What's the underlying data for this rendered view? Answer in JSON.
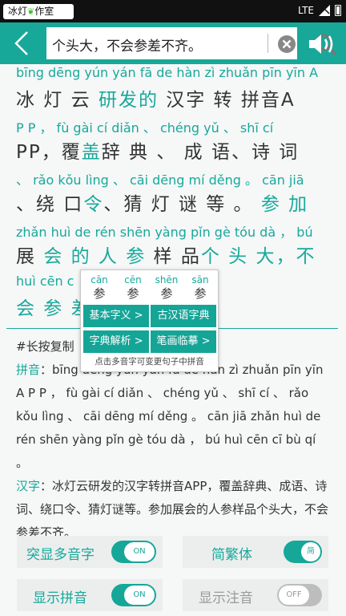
{
  "status_bar": {
    "app_logo_text": "冰灯",
    "app_logo_text2": "作室",
    "network": "LTE"
  },
  "search": {
    "query": "个头大，不会参差不齐。"
  },
  "result": {
    "lines": [
      {
        "py": "bīng dēng yún yán fā  de hàn  zì  zhuǎn pīn yīn A",
        "hz_plain": "冰 灯 云",
        "hz_teal": "研发的",
        "hz_rest": "汉字 转 拼音A"
      },
      {
        "py": "P P ，   fù gài cí diǎn 、  chéng yǔ 、  shī cí",
        "hz_plain": "PP，覆",
        "hz_teal": "盖",
        "hz_rest": "辞 典 、  成 语、诗 词"
      },
      {
        "py": "、 rǎo kǒu lìng 、  cāi dēng mí děng 。 cān jiā",
        "hz_plain": "、绕 口",
        "hz_teal": "令",
        "hz_rest": "、猜 灯 谜 等 。",
        "hz_teal2": "参 加"
      },
      {
        "py": "zhǎn huì de rén shēn yàng pǐn gè tóu dà ，  bú",
        "hz_plain": "展",
        "hz_teal": "会 的 人 参",
        "hz_rest": " 样 品",
        "hz_teal2": "个 头 大，不"
      },
      {
        "py": "huì cēn c",
        "hz_plain": "",
        "hz_teal": "会 参 差",
        "hz_rest": ""
      }
    ]
  },
  "popup": {
    "options": [
      {
        "py": "cān",
        "hz": "参"
      },
      {
        "py": "cēn",
        "hz": "参"
      },
      {
        "py": "shēn",
        "hz": "参"
      },
      {
        "py": "sān",
        "hz": "参"
      }
    ],
    "buttons": [
      "基本字义 >",
      "古汉语字典",
      "字典解析 >",
      "笔画临摹 >"
    ],
    "tip": "点击多音字可变更句子中拼音"
  },
  "info": {
    "copy_hint": "#长按复制",
    "copy_hint_tail": "制",
    "pinyin_label": "拼音",
    "pinyin_text": "：bīng dēng yún yán fā de hàn zì zhuǎn pīn yīn A P P ， fù gài cí diǎn 、 chéng yǔ 、 shī cí 、 rǎo kǒu lìng 、 cāi dēng mí děng 。 cān jiā zhǎn huì de rén shēn yàng pǐn gè tóu dà ， bú huì cēn cī bù qí 。",
    "hanzi_label": "汉字",
    "hanzi_text": "：冰灯云研发的汉字转拼音APP，覆盖辞典、成语、诗词、绕口令、猜灯谜等。参加展会的人参样品个头大，不会参差不齐。"
  },
  "toggles": [
    {
      "label": "突显多音字",
      "state": "ON"
    },
    {
      "label": "简繁体",
      "state": "简"
    },
    {
      "label": "显示拼音",
      "state": "ON"
    },
    {
      "label": "显示注音",
      "state": "OFF"
    }
  ]
}
